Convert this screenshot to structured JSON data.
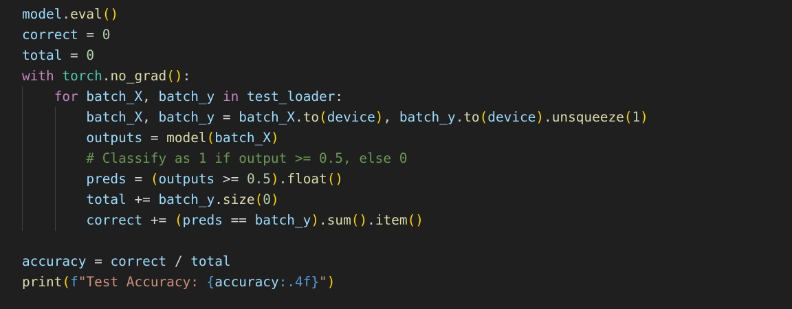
{
  "code": {
    "l1": {
      "model": "model",
      "dot": ".",
      "eval": "eval",
      "po": "(",
      "pc": ")"
    },
    "l2": {
      "var": "correct",
      "eq": " = ",
      "val": "0"
    },
    "l3": {
      "var": "total",
      "eq": " = ",
      "val": "0"
    },
    "l4": {
      "kw": "with",
      "sp": " ",
      "torch": "torch",
      "dot": ".",
      "fn": "no_grad",
      "po": "(",
      "pc": ")",
      "colon": ":"
    },
    "l5": {
      "indent": "    ",
      "for": "for",
      "s1": " ",
      "bx": "batch_X",
      "comma": ", ",
      "by": "batch_y",
      "s2": " ",
      "in": "in",
      "s3": " ",
      "loader": "test_loader",
      "colon": ":"
    },
    "l6": {
      "indent": "        ",
      "bx": "batch_X",
      "comma1": ", ",
      "by": "batch_y",
      "eq": " = ",
      "bx2": "batch_X",
      "dot1": ".",
      "to1": "to",
      "po1": "(",
      "dev1": "device",
      "pc1": ")",
      "comma2": ", ",
      "by2": "batch_y",
      "dot2": ".",
      "to2": "to",
      "po2": "(",
      "dev2": "device",
      "pc2": ")",
      "dot3": ".",
      "unsq": "unsqueeze",
      "po3": "(",
      "one": "1",
      "pc3": ")"
    },
    "l7": {
      "indent": "        ",
      "outputs": "outputs",
      "eq": " = ",
      "model": "model",
      "po": "(",
      "bx": "batch_X",
      "pc": ")"
    },
    "l8": {
      "indent": "        ",
      "comment": "# Classify as 1 if output >= 0.5, else 0"
    },
    "l9": {
      "indent": "        ",
      "preds": "preds",
      "eq": " = ",
      "po": "(",
      "outputs": "outputs",
      "ge": " >= ",
      "half": "0.5",
      "pc": ")",
      "dot": ".",
      "float": "float",
      "po2": "(",
      "pc2": ")"
    },
    "l10": {
      "indent": "        ",
      "total": "total",
      "pe": " += ",
      "by": "batch_y",
      "dot": ".",
      "size": "size",
      "po": "(",
      "zero": "0",
      "pc": ")"
    },
    "l11": {
      "indent": "        ",
      "correct": "correct",
      "pe": " += ",
      "po": "(",
      "preds": "preds",
      "eqeq": " == ",
      "by": "batch_y",
      "pc": ")",
      "dot1": ".",
      "sum": "sum",
      "po2": "(",
      "pc2": ")",
      "dot2": ".",
      "item": "item",
      "po3": "(",
      "pc3": ")"
    },
    "l12": {
      "blank": ""
    },
    "l13": {
      "acc": "accuracy",
      "eq": " = ",
      "correct": "correct",
      "div": " / ",
      "total": "total"
    },
    "l14": {
      "print": "print",
      "po": "(",
      "f": "f",
      "str1": "\"Test Accuracy: ",
      "bo": "{",
      "acc": "accuracy",
      "fmt": ":.4f",
      "bc": "}",
      "str2": "\"",
      "pc": ")"
    }
  },
  "colors": {
    "background": "#1f1f1f",
    "variable": "#9cdcfe",
    "function": "#dcdcaa",
    "keyword": "#c586c0",
    "number": "#b5cea8",
    "comment": "#6a9955",
    "string": "#ce9178",
    "bracket": "#ffd700"
  }
}
